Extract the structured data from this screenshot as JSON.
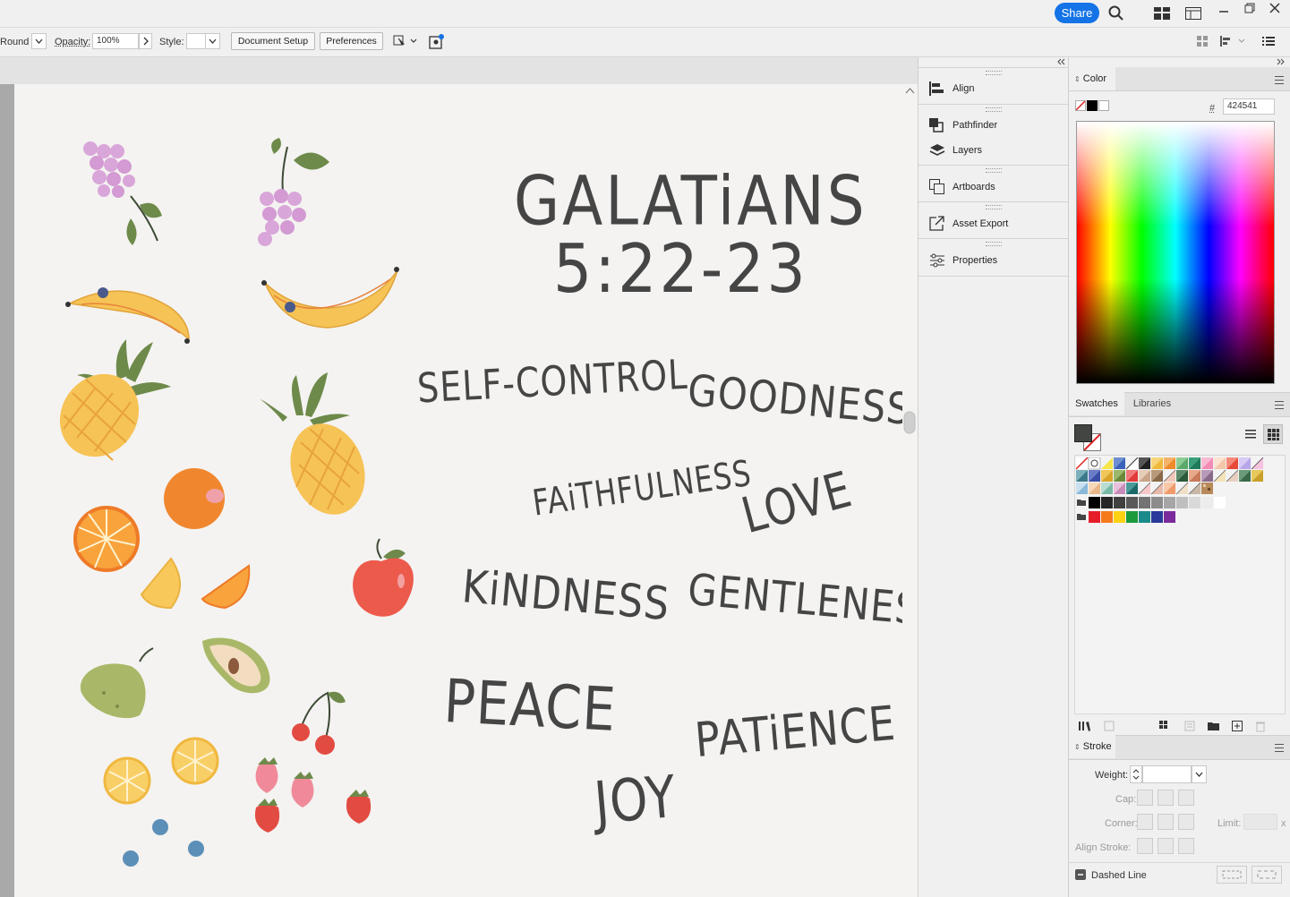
{
  "titlebar": {
    "share_label": "Share"
  },
  "control_bar": {
    "brush_value": "Round",
    "opacity_label": "Opacity:",
    "opacity_value": "100%",
    "style_label": "Style:",
    "document_setup_label": "Document Setup",
    "preferences_label": "Preferences"
  },
  "artboard": {
    "title_line1": "GALATiANS",
    "title_line2": "5:22-23",
    "words": {
      "self_control": "SELF-CONTROL",
      "goodness": "GOODNESS",
      "faithfulness": "FAiTHFULNESS",
      "love": "LOVE",
      "kindness": "KiNDNESS",
      "gentleness": "GENTLENESS",
      "peace": "PEACE",
      "patience": "PATiENCE",
      "joy": "JOY"
    }
  },
  "dock_panels": [
    {
      "label": "Align",
      "icon": "align-icon"
    },
    {
      "label": "Pathfinder",
      "icon": "pathfinder-icon"
    },
    {
      "label": "Layers",
      "icon": "layers-icon"
    },
    {
      "label": "Artboards",
      "icon": "artboards-icon"
    },
    {
      "label": "Asset Export",
      "icon": "asset-export-icon"
    },
    {
      "label": "Properties",
      "icon": "properties-icon"
    }
  ],
  "color_panel": {
    "title": "Color",
    "hash_label": "#",
    "hex_value": "424541"
  },
  "swatches_panel": {
    "tab_swatches": "Swatches",
    "tab_libraries": "Libraries"
  },
  "stroke_panel": {
    "title": "Stroke",
    "weight_label": "Weight:",
    "cap_label": "Cap:",
    "corner_label": "Corner:",
    "limit_label": "Limit:",
    "limit_suffix": "x",
    "align_stroke_label": "Align Stroke:",
    "dashed_line_label": "Dashed Line"
  },
  "colors": {
    "accent": "#1473e6",
    "text_ink": "#454545",
    "fill": "#424541"
  }
}
